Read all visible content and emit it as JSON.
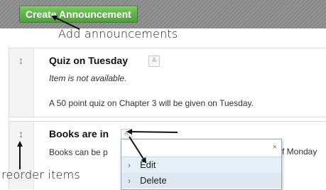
{
  "toolbar": {
    "create_button_label": "Create Announcement"
  },
  "annotations": {
    "add": "Add announcements",
    "reorder": "reorder items"
  },
  "items": [
    {
      "title": "Quiz on Tuesday",
      "availability": "Item is not available.",
      "body": "A 50 point quiz on Chapter 3 will be given on Tuesday."
    },
    {
      "title": "Books are in",
      "body": "Books can be p",
      "body_tail": "f Monday"
    }
  ],
  "context_menu": {
    "close_glyph": "×",
    "items": [
      {
        "label": "Edit",
        "caret": "›"
      },
      {
        "label": "Delete",
        "caret": "›"
      }
    ]
  },
  "icons": {
    "handle": "↕",
    "chevron": "≚"
  }
}
